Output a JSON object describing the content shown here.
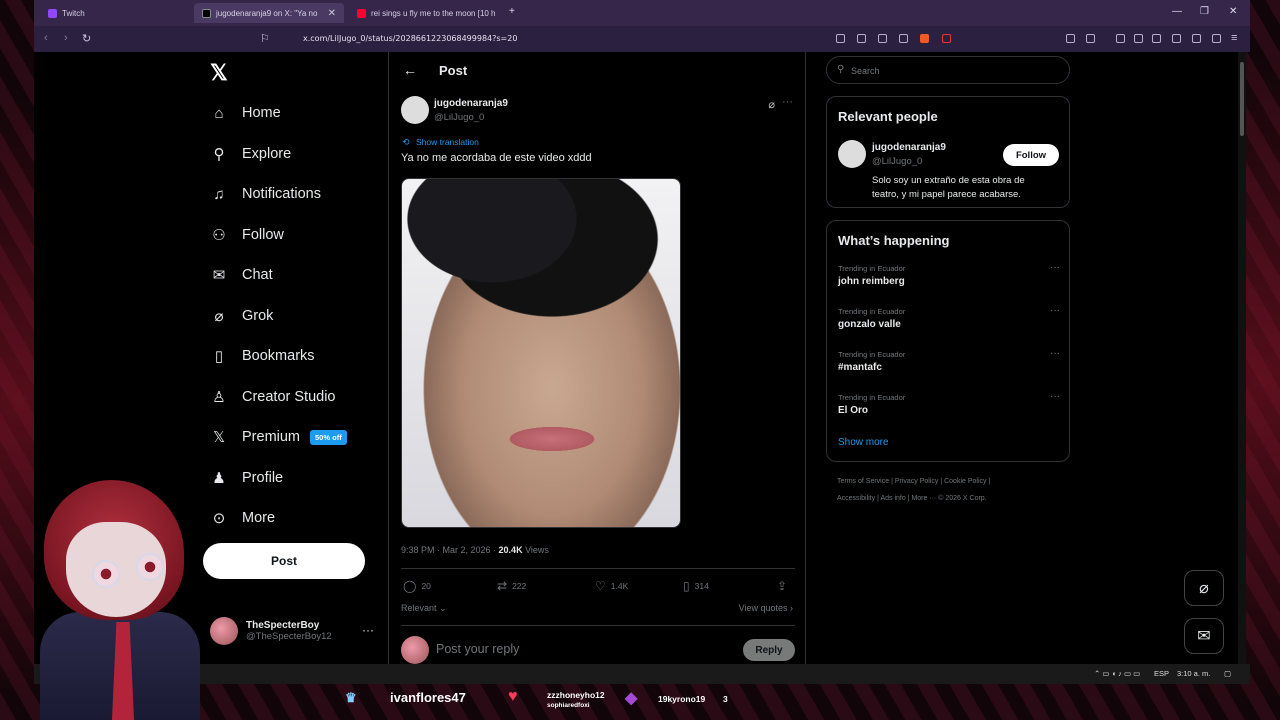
{
  "browser": {
    "tabs": [
      {
        "label": "Twitch",
        "active": false
      },
      {
        "label": "jugodenaranja9 on X: \"Ya no",
        "active": true
      },
      {
        "label": "rei sings u fly me to the moon [10 h",
        "active": false
      }
    ],
    "url": "x.com/LilJugo_0/status/2028661223068499984?s=20"
  },
  "nav": {
    "items": [
      {
        "label": "Home",
        "icon": "home-icon"
      },
      {
        "label": "Explore",
        "icon": "search-icon"
      },
      {
        "label": "Notifications",
        "icon": "bell-icon"
      },
      {
        "label": "Follow",
        "icon": "add-person-icon"
      },
      {
        "label": "Chat",
        "icon": "mail-icon"
      },
      {
        "label": "Grok",
        "icon": "grok-icon"
      },
      {
        "label": "Bookmarks",
        "icon": "bookmark-icon"
      },
      {
        "label": "Creator Studio",
        "icon": "creator-icon"
      },
      {
        "label": "Premium",
        "icon": "x-icon"
      },
      {
        "label": "Profile",
        "icon": "person-icon"
      },
      {
        "label": "More",
        "icon": "more-circle-icon"
      }
    ],
    "premium_badge": "50% off",
    "post_button": "Post",
    "account": {
      "name": "TheSpecterBoy",
      "handle": "@TheSpecterBoy12"
    }
  },
  "post": {
    "header": "Post",
    "author_name": "jugodenaranja9",
    "author_handle": "@LilJugo_0",
    "show_translation": "Show translation",
    "text": "Ya no me acordaba de este video xddd",
    "time": "9:38 PM · Mar 2, 2026 · ",
    "views_count": "20.4K",
    "views_label": " Views",
    "replies": "20",
    "reposts": "222",
    "likes": "1.4K",
    "bookmarks": "314",
    "relevant": "Relevant",
    "view_quotes": "View quotes",
    "reply_placeholder": "Post your reply",
    "reply_button": "Reply"
  },
  "sidebar": {
    "search_placeholder": "Search",
    "relevant_people": {
      "title": "Relevant people",
      "name": "jugodenaranja9",
      "handle": "@LilJugo_0",
      "follow": "Follow",
      "bio": "Solo soy un extraño de esta obra de teatro, y mi papel parece acabarse."
    },
    "happening": {
      "title": "What’s happening",
      "trends": [
        {
          "category": "Trending in Ecuador",
          "topic": "john reimberg"
        },
        {
          "category": "Trending in Ecuador",
          "topic": "gonzalo valle"
        },
        {
          "category": "Trending in Ecuador",
          "topic": "#mantafc"
        },
        {
          "category": "Trending in Ecuador",
          "topic": "El Oro"
        }
      ],
      "show_more": "Show more"
    },
    "footer": {
      "line1": "Terms of Service  |  Privacy Policy  |  Cookie Policy  |",
      "line2": "Accessibility  |  Ads info  |  More ···  © 2026 X Corp."
    }
  },
  "taskbar": {
    "lang": "ESP",
    "time": "3:10 a. m."
  },
  "overlay": {
    "user1": "ivanflores47",
    "user2": "zzzhoneyho12",
    "user2_sub": "sophiaredfoxi",
    "user3": "19kyrono19",
    "user3_count": "3"
  },
  "colors": {
    "accent": "#1d9bf0",
    "tab_bar": "#35264a"
  }
}
